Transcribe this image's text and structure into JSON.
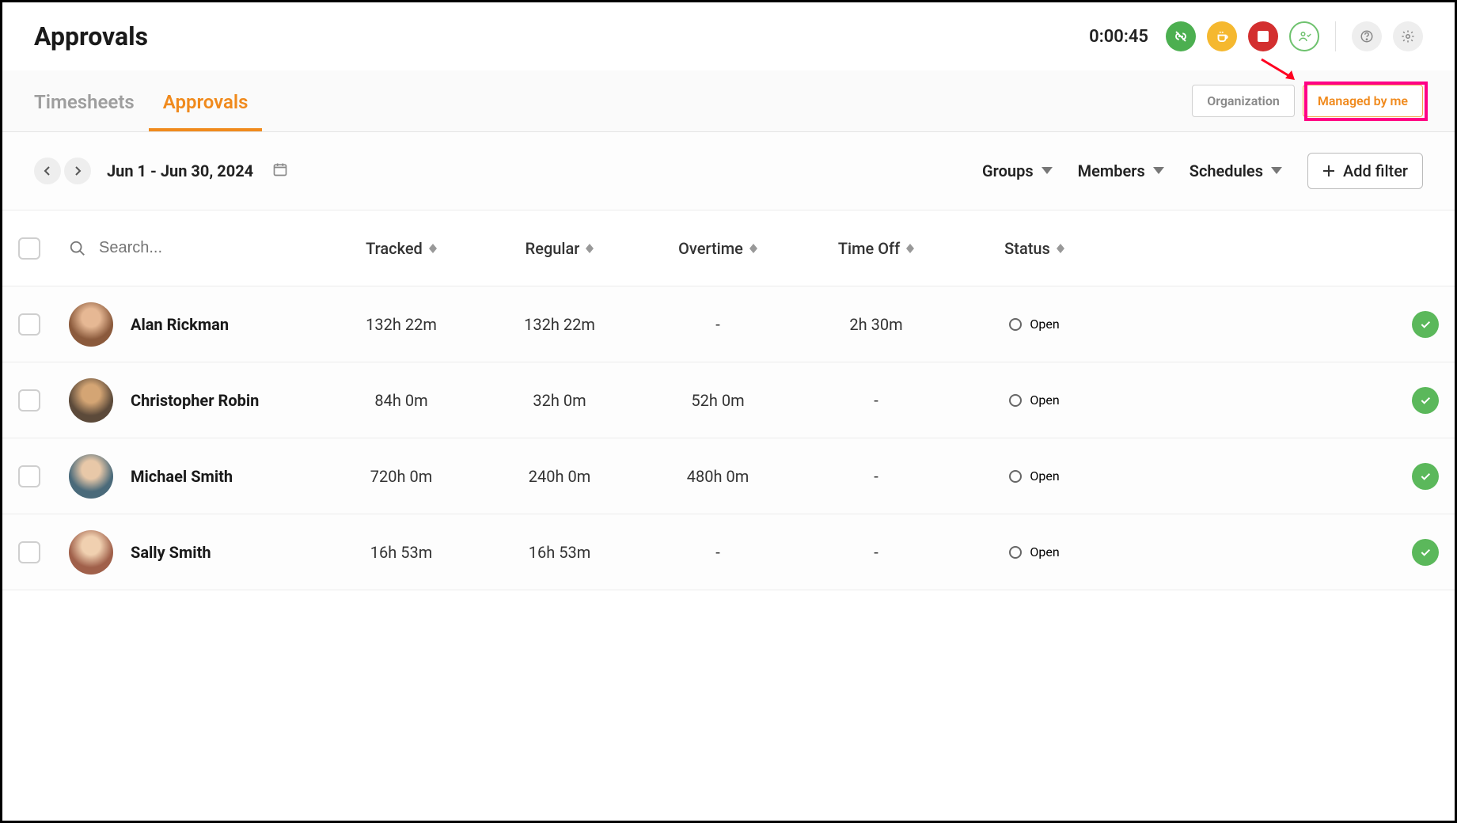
{
  "header": {
    "title": "Approvals",
    "timer": "0:00:45"
  },
  "tabs": {
    "items": [
      {
        "label": "Timesheets",
        "active": false
      },
      {
        "label": "Approvals",
        "active": true
      }
    ]
  },
  "scope": {
    "organization": "Organization",
    "managed": "Managed by me"
  },
  "filters": {
    "date_range": "Jun 1 - Jun 30, 2024",
    "groups_label": "Groups",
    "members_label": "Members",
    "schedules_label": "Schedules",
    "add_filter_label": "Add filter"
  },
  "columns": {
    "search_placeholder": "Search...",
    "tracked": "Tracked",
    "regular": "Regular",
    "overtime": "Overtime",
    "timeoff": "Time Off",
    "status": "Status"
  },
  "rows": [
    {
      "name": "Alan Rickman",
      "tracked": "132h 22m",
      "regular": "132h 22m",
      "overtime": "-",
      "timeoff": "2h 30m",
      "status": "Open"
    },
    {
      "name": "Christopher Robin",
      "tracked": "84h 0m",
      "regular": "32h 0m",
      "overtime": "52h 0m",
      "timeoff": "-",
      "status": "Open"
    },
    {
      "name": "Michael Smith",
      "tracked": "720h 0m",
      "regular": "240h 0m",
      "overtime": "480h 0m",
      "timeoff": "-",
      "status": "Open"
    },
    {
      "name": "Sally Smith",
      "tracked": "16h 53m",
      "regular": "16h 53m",
      "overtime": "-",
      "timeoff": "-",
      "status": "Open"
    }
  ]
}
